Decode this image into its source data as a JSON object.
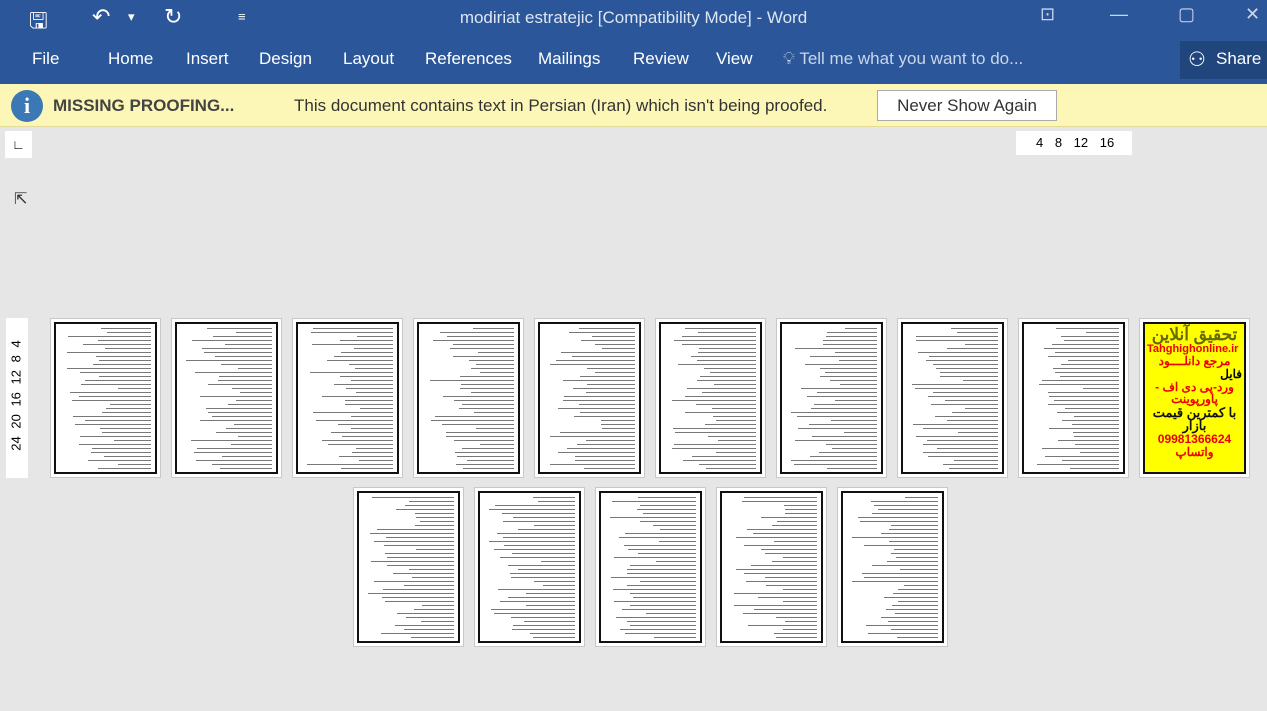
{
  "window": {
    "title": "modiriat estratejic [Compatibility Mode] - Word",
    "minimize": "—",
    "restore": "▢",
    "close": "✕",
    "ribbon_display": "⊡"
  },
  "quick_access": {
    "save": "🖫",
    "undo": "↶",
    "undo_dropdown": "▾",
    "redo": "↻",
    "customize": "≡"
  },
  "ribbon": {
    "tabs": [
      "File",
      "Home",
      "Insert",
      "Design",
      "Layout",
      "References",
      "Mailings",
      "Review",
      "View"
    ],
    "tell_me": "Tell me what you want to do...",
    "share": "Share"
  },
  "message_bar": {
    "title": "MISSING PROOFING...",
    "text": "This document contains text in Persian (Iran) which isn't being proofed.",
    "button": "Never Show Again"
  },
  "rulers": {
    "horizontal": "4 8 12 16",
    "vertical": "24 20 16 12 8 4",
    "tab_selector": "∟"
  },
  "ad_page": {
    "title": "تحقیق آنلاین",
    "site": "Tahghighonline.ir",
    "line1": "مرجع دانلــــود",
    "line2": "فایل",
    "line3": "ورد-پی دی اف - پاورپوینت",
    "line4": "با کمترین قیمت بازار",
    "phone": "09981366624 واتساپ"
  },
  "pages": {
    "row1_count": 10,
    "row2_count": 5
  }
}
